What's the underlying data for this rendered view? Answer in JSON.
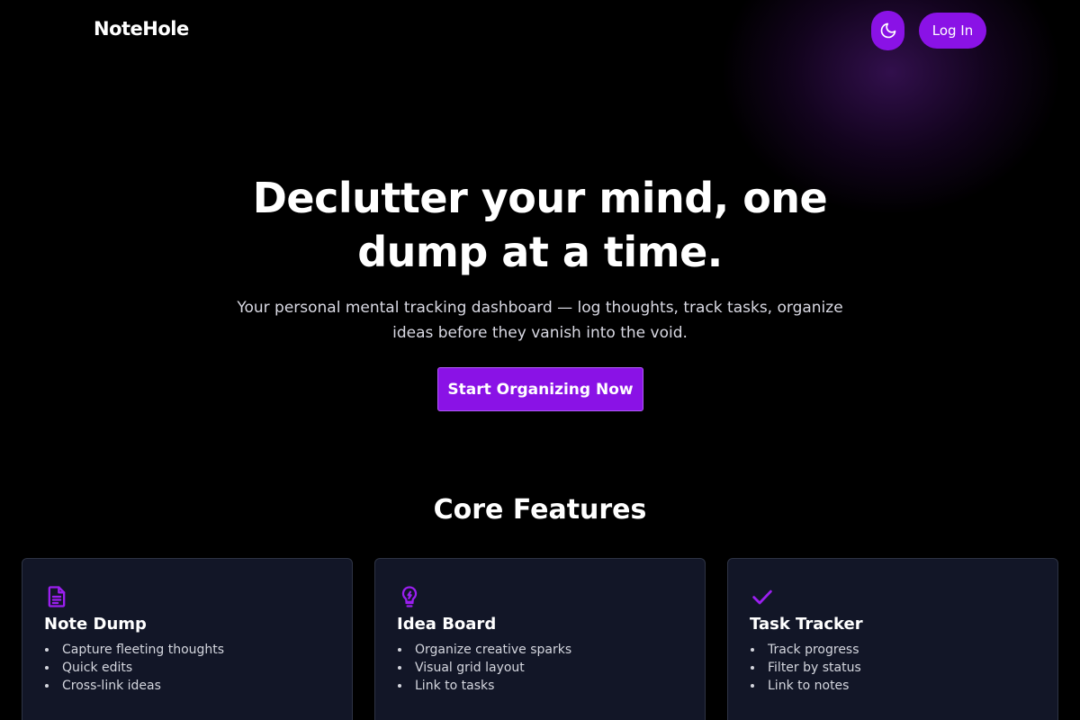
{
  "brand": {
    "name": "NoteHole",
    "accent": "#8a12e6"
  },
  "header": {
    "theme_icon": "moon-icon",
    "login_label": "Log In"
  },
  "hero": {
    "title": "Declutter your mind, one dump at a time.",
    "subtitle": "Your personal mental tracking dashboard — log thoughts, track tasks, organize ideas before they vanish into the void.",
    "cta_label": "Start Organizing Now"
  },
  "features": {
    "heading": "Core Features",
    "cards": [
      {
        "icon": "document-icon",
        "title": "Note Dump",
        "items": [
          "Capture fleeting thoughts",
          "Quick edits",
          "Cross-link ideas"
        ]
      },
      {
        "icon": "lightbulb-icon",
        "title": "Idea Board",
        "items": [
          "Organize creative sparks",
          "Visual grid layout",
          "Link to tasks"
        ]
      },
      {
        "icon": "checkmark-icon",
        "title": "Task Tracker",
        "items": [
          "Track progress",
          "Filter by status",
          "Link to notes"
        ]
      }
    ]
  }
}
